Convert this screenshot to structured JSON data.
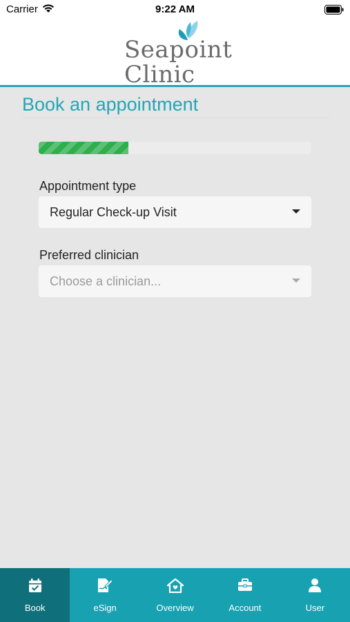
{
  "status_bar": {
    "carrier": "Carrier",
    "time": "9:22 AM"
  },
  "header": {
    "logo_line1": "Seapoint",
    "logo_line2": "Clinic",
    "accent_color": "#2aa3b3"
  },
  "page": {
    "title": "Book an appointment"
  },
  "progress": {
    "percent": 33
  },
  "form": {
    "appointment_type": {
      "label": "Appointment type",
      "value": "Regular Check-up Visit"
    },
    "preferred_clinician": {
      "label": "Preferred clinician",
      "placeholder": "Choose a clinician..."
    }
  },
  "tab_bar": {
    "background_color": "#18a2b1",
    "active_color": "#0f6f7a",
    "tabs": [
      {
        "label": "Book",
        "icon": "calendar-check-icon",
        "active": true
      },
      {
        "label": "eSign",
        "icon": "signature-icon",
        "active": false
      },
      {
        "label": "Overview",
        "icon": "home-icon",
        "active": false
      },
      {
        "label": "Account",
        "icon": "briefcase-icon",
        "active": false
      },
      {
        "label": "User",
        "icon": "user-icon",
        "active": false
      }
    ]
  }
}
